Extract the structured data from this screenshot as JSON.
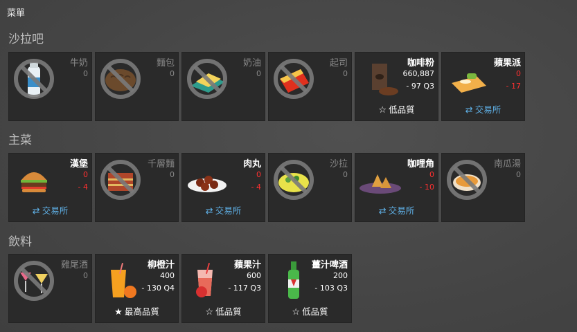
{
  "panel_title": "菜單",
  "sections": [
    {
      "title": "沙拉吧"
    },
    {
      "title": "主菜"
    },
    {
      "title": "飲料"
    }
  ],
  "footers": {
    "trade": "交易所",
    "low_quality": "低品質",
    "top_quality": "最高品質"
  },
  "items": {
    "milk": {
      "name": "牛奶",
      "v1": "0"
    },
    "bread": {
      "name": "麵包",
      "v1": "0"
    },
    "butter": {
      "name": "奶油",
      "v1": "0"
    },
    "cheese": {
      "name": "起司",
      "v1": "0"
    },
    "coffee": {
      "name": "咖啡粉",
      "v1": "660,887",
      "v2": "- 97 Q3"
    },
    "applepie": {
      "name": "蘋果派",
      "v1": "0",
      "v2": "- 17"
    },
    "burger": {
      "name": "漢堡",
      "v1": "0",
      "v2": "- 4"
    },
    "lasagna": {
      "name": "千層麵",
      "v1": "0"
    },
    "meatball": {
      "name": "肉丸",
      "v1": "0",
      "v2": "- 4"
    },
    "salad": {
      "name": "沙拉",
      "v1": "0"
    },
    "samosa": {
      "name": "咖哩角",
      "v1": "0",
      "v2": "- 10"
    },
    "pumpkin": {
      "name": "南瓜湯",
      "v1": "0"
    },
    "cocktail": {
      "name": "雞尾酒",
      "v1": "0"
    },
    "orange": {
      "name": "柳橙汁",
      "v1": "400",
      "v2": "- 130 Q4"
    },
    "applejuice": {
      "name": "蘋果汁",
      "v1": "600",
      "v2": "- 117 Q3"
    },
    "gingerbeer": {
      "name": "薑汁啤酒",
      "v1": "200",
      "v2": "- 103 Q3"
    }
  },
  "colors": {
    "trade": "#5fb0e6",
    "negative": "#ff3030"
  },
  "icons": {
    "milk": "milk-bottle-icon",
    "bread": "bread-icon",
    "butter": "butter-icon",
    "cheese": "cheese-icon",
    "coffee": "coffee-bag-icon",
    "applepie": "apple-pie-icon",
    "burger": "burger-icon",
    "lasagna": "lasagna-icon",
    "meatball": "meatball-icon",
    "salad": "salad-icon",
    "samosa": "samosa-icon",
    "pumpkin": "pumpkin-soup-icon",
    "cocktail": "cocktail-icon",
    "orange": "orange-juice-icon",
    "applejuice": "apple-juice-icon",
    "gingerbeer": "ginger-beer-icon",
    "ban": "ban-icon",
    "trade": "swap-arrows-icon",
    "star": "star-icon"
  }
}
